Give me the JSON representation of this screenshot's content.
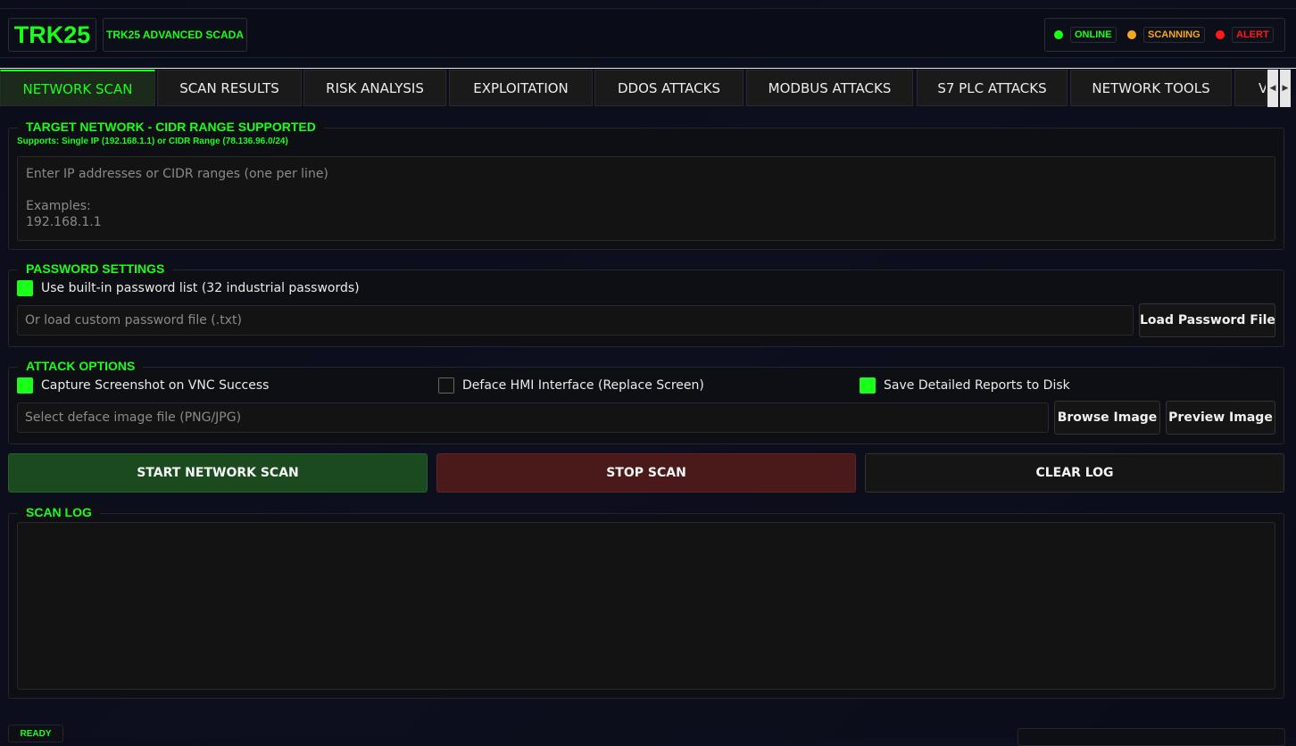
{
  "header": {
    "logo": "TRK25",
    "subtitle": "TRK25 ADVANCED SCADA",
    "status": [
      {
        "label": "ONLINE",
        "color": "#1aff1a"
      },
      {
        "label": "SCANNING",
        "color": "#f5a623"
      },
      {
        "label": "ALERT",
        "color": "#ff1a1a"
      }
    ]
  },
  "tabs": [
    "NETWORK SCAN",
    "SCAN RESULTS",
    "RISK ANALYSIS",
    "EXPLOITATION",
    "DDOS ATTACKS",
    "MODBUS ATTACKS",
    "S7 PLC ATTACKS",
    "NETWORK TOOLS",
    "V"
  ],
  "target": {
    "title": "TARGET NETWORK - CIDR RANGE SUPPORTED",
    "hint": "Supports: Single IP (192.168.1.1) or CIDR Range (78.136.96.0/24)",
    "placeholder": "Enter IP addresses or CIDR ranges (one per line)\n\nExamples:\n192.168.1.1"
  },
  "password": {
    "title": "PASSWORD SETTINGS",
    "builtin_label": "Use built-in password list (32 industrial passwords)",
    "builtin_checked": true,
    "file_placeholder": "Or load custom password file (.txt)",
    "load_button": "Load Password File"
  },
  "attack": {
    "title": "ATTACK OPTIONS",
    "options": [
      {
        "label": "Capture Screenshot on VNC Success",
        "checked": true
      },
      {
        "label": "Deface HMI Interface (Replace Screen)",
        "checked": false
      },
      {
        "label": "Save Detailed Reports to Disk",
        "checked": true
      }
    ],
    "image_placeholder": "Select deface image file (PNG/JPG)",
    "browse_button": "Browse Image",
    "preview_button": "Preview Image"
  },
  "actions": {
    "start": "START NETWORK SCAN",
    "stop": "STOP SCAN",
    "clear": "CLEAR LOG"
  },
  "log": {
    "title": "SCAN LOG"
  },
  "footer": {
    "status": "READY"
  },
  "colors": {
    "accent": "#1aff1a",
    "start_bg": "#1b4a1f",
    "stop_bg": "#4a1a1a"
  }
}
